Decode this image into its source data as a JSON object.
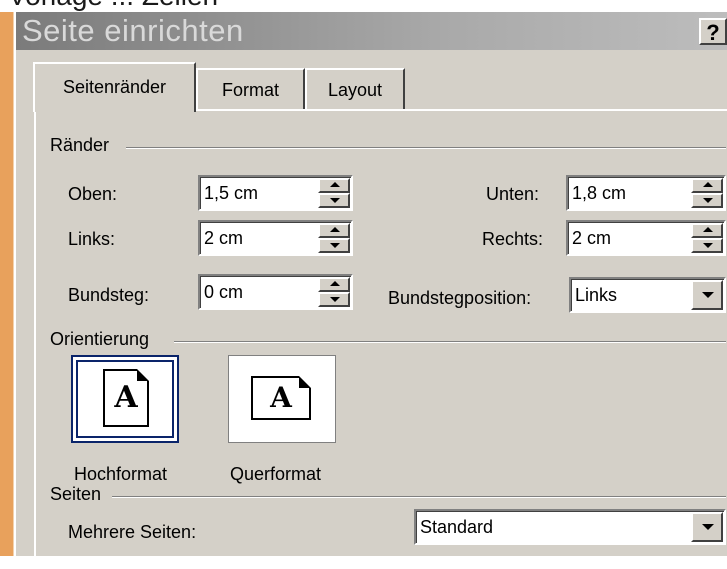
{
  "caption": "Vorlage ... Zeilen",
  "title": "Seite einrichten",
  "help": "?",
  "tabs": [
    "Seitenränder",
    "Format",
    "Layout"
  ],
  "raender": {
    "group": "Ränder",
    "oben": {
      "label": "Oben:",
      "value": "1,5 cm"
    },
    "links": {
      "label": "Links:",
      "value": "2 cm"
    },
    "bundsteg": {
      "label": "Bundsteg:",
      "value": "0 cm"
    },
    "unten": {
      "label": "Unten:",
      "value": "1,8 cm"
    },
    "rechts": {
      "label": "Rechts:",
      "value": "2 cm"
    },
    "bundstegposition": {
      "label": "Bundstegposition:",
      "value": "Links"
    }
  },
  "orientierung": {
    "group": "Orientierung",
    "hoch": "Hochformat",
    "quer": "Querformat",
    "glyph": "A",
    "selected": "Hochformat"
  },
  "seiten": {
    "group": "Seiten",
    "label": "Mehrere Seiten:",
    "value": "Standard"
  }
}
